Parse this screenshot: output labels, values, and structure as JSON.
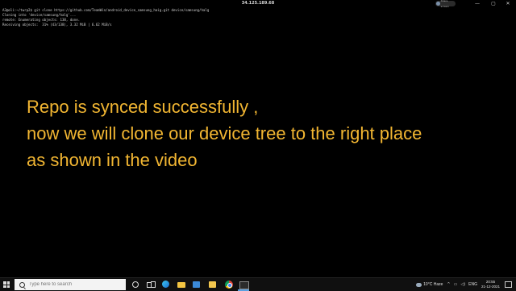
{
  "window": {
    "title": "34.125.189.68",
    "badge_text": "Share screen",
    "minimize": "—",
    "maximize": "▢",
    "close": "✕"
  },
  "terminal": {
    "lines": [
      "A3@oli:~/twrp2$ git clone https://github.com/TeamWin/android_device_samsung_haig.git device/samsung/halg",
      "Cloning into 'device/samsung/halg'...",
      "remote: Enumerating objects: 138, done.",
      "Receiving objects:  31% (43/138), 3.32 MiB | 6.62 MiB/s"
    ]
  },
  "caption": {
    "lines": [
      "Repo is synced successfully ,",
      "now we will clone our device tree to the right place",
      "as shown in the video"
    ],
    "color": "#f2b632"
  },
  "taskbar": {
    "search_placeholder": "Type here to search",
    "pinned": [
      "cortana-icon",
      "task-view-icon",
      "edge-icon",
      "file-explorer-icon",
      "store-icon",
      "app-icon",
      "chrome-icon",
      "terminal-icon"
    ],
    "weather": "10°C  Haze",
    "language": "ENG",
    "time": "20:55",
    "date": "21-12-2021"
  }
}
